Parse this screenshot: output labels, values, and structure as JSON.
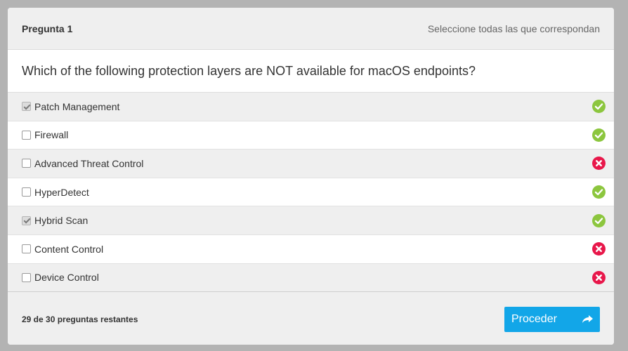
{
  "header": {
    "question_number": "Pregunta 1",
    "instruction": "Seleccione todas las que correspondan"
  },
  "question": {
    "text": "Which of the following protection layers are NOT available for macOS endpoints?"
  },
  "options": [
    {
      "label": "Patch Management",
      "checked": true,
      "status": "correct"
    },
    {
      "label": "Firewall",
      "checked": false,
      "status": "correct"
    },
    {
      "label": "Advanced Threat Control",
      "checked": false,
      "status": "incorrect"
    },
    {
      "label": "HyperDetect",
      "checked": false,
      "status": "correct"
    },
    {
      "label": "Hybrid Scan",
      "checked": true,
      "status": "correct"
    },
    {
      "label": "Content Control",
      "checked": false,
      "status": "incorrect"
    },
    {
      "label": "Device Control",
      "checked": false,
      "status": "incorrect"
    }
  ],
  "footer": {
    "remaining": "29 de 30 preguntas restantes",
    "proceed_label": "Proceder"
  },
  "colors": {
    "correct": "#8cc63e",
    "incorrect": "#e8174a",
    "accent": "#12a6e8"
  },
  "icons": {
    "correct": "check-circle-icon",
    "incorrect": "x-circle-icon",
    "proceed": "share-arrow-icon"
  }
}
